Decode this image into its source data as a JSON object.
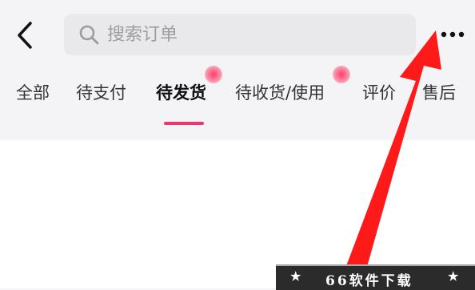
{
  "header": {
    "search_placeholder": "搜索订单"
  },
  "tabs": [
    {
      "label": "全部"
    },
    {
      "label": "待支付"
    },
    {
      "label": "待发货"
    },
    {
      "label": "待收货/使用"
    },
    {
      "label": "评价"
    },
    {
      "label": "售后"
    }
  ],
  "active_tab": "待发货",
  "colors": {
    "accent": "#e8396e",
    "arrow": "#ff1a1a",
    "background": "#f4f4f6"
  },
  "icons": [
    "back-icon",
    "search-icon",
    "more-icon"
  ],
  "watermark": {
    "text": "66软件下载",
    "star": "★"
  }
}
